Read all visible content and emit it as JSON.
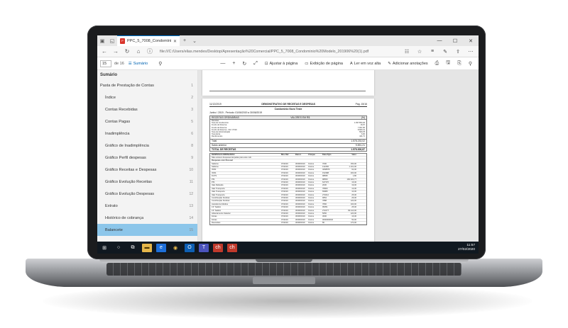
{
  "browser": {
    "tab_title": "PPC_5_7008_Condomínio",
    "url": "file:///C:/Users/elias.mendes/Desktop/Apresentação%20Comercial/PPC_5_7008_Condominio%20Modelo_201906%20(1).pdf"
  },
  "pdf_toolbar": {
    "page_current": "15",
    "page_total": "de 16",
    "summary": "Sumário",
    "fit_page": "Ajustar à página",
    "page_view": "Exibição de página",
    "read_aloud": "Ler em voz alta",
    "add_notes": "Adicionar anotações"
  },
  "sidebar": {
    "title": "Sumário",
    "items": [
      {
        "label": "Pasta de Prestação de Contas",
        "page": "1"
      },
      {
        "label": "Índice",
        "page": "2"
      },
      {
        "label": "Contas Recebidas",
        "page": "3"
      },
      {
        "label": "Contas Pagas",
        "page": "5"
      },
      {
        "label": "Inadimplência",
        "page": "6"
      },
      {
        "label": "Gráfico de Inadimplência",
        "page": "8"
      },
      {
        "label": "Gráfico Perfil despesas",
        "page": "9"
      },
      {
        "label": "Gráfico Receitas e Despesas",
        "page": "10"
      },
      {
        "label": "Gráfico Evolução Receitas",
        "page": "11"
      },
      {
        "label": "Gráfico Evolução Despesas",
        "page": "12"
      },
      {
        "label": "Extrato",
        "page": "13"
      },
      {
        "label": "Histórico de cobrança",
        "page": "14"
      },
      {
        "label": "Balancete",
        "page": "15"
      }
    ]
  },
  "document": {
    "date": "11/12/2019",
    "title": "DEMONSTRATIVO DE RECEITAS E DESPESAS",
    "page_label": "Pág. 15/16",
    "company": "Condomínio Novo Teste",
    "period": "Junho / 2019 - Período: 01/06/2019 a 30/06/2019",
    "receipts_header": "RECEITAS ORDINÁRIAS",
    "receipts_value_header": "VALORES EM R$",
    "receipts_pct_header": "(%)",
    "receipts_rows": [
      [
        "Receitas",
        ""
      ],
      [
        "Taxa de Condomínio",
        "1.097.850,46"
      ],
      [
        "Fundo de Reserva",
        "16,67"
      ],
      [
        "Fundo de Reserva",
        "7.097,96"
      ],
      [
        "Fundo de Reserva - Ref. 07/19",
        "8.683,41"
      ],
      [
        "Taxa de Administração",
        "569,78"
      ],
      [
        "Taxa Extra",
        "6,00"
      ],
      [
        "Rendimentos",
        "441,71"
      ]
    ],
    "total_label": "Total",
    "total_value": "1.578.233,02",
    "prev_balance_label": "Saldo anterior",
    "prev_balance": "9.591,21",
    "receipts_total_label": "TOTAL DE RECEITAS",
    "receipts_total": "1.578.306,87",
    "expenses_header": "DESPESAS ORDINÁRIAS",
    "expenses_cols": [
      "Mês Ref.",
      "Banco",
      "Cheque",
      "Data Pgto",
      "Valor"
    ],
    "expenses_note": "Não existem despesas lançadas para este mês",
    "expenses_section": "Despesas com Pessoal",
    "expenses_rows": [
      [
        "Salários",
        "07/2019",
        "30/08/2019",
        "Outros",
        "7000",
        "150,00"
      ],
      [
        "Salários",
        "07/2019",
        "30/08/2019",
        "Outros",
        "132460",
        "1.101,00"
      ],
      [
        "INSS",
        "07/2019",
        "30/08/2019",
        "Outros",
        "4068876",
        "62,00"
      ],
      [
        "INSS",
        "07/2019",
        "30/08/2019",
        "Outros",
        "152388",
        "200,00"
      ],
      [
        "FGTS",
        "07/2019",
        "30/08/2019",
        "Outros",
        "98835",
        "1,80"
      ],
      [
        "PIS",
        "07/2019",
        "30/08/2019",
        "Outros",
        "98650",
        "160.320,77"
      ],
      [
        "PIS",
        "07/2019",
        "30/08/2019",
        "Outros",
        "647370",
        "16,00"
      ],
      [
        "Vale Refeição",
        "07/2019",
        "30/08/2019",
        "Outros",
        "2030",
        "19,00"
      ],
      [
        "Vale Transporte",
        "07/2019",
        "30/08/2019",
        "Outros",
        "78900",
        "13,00"
      ],
      [
        "Vale Transporte",
        "07/2019",
        "30/08/2019",
        "Outros",
        "69980",
        "10,00"
      ],
      [
        "Vale Transporte",
        "07/2019",
        "30/08/2019",
        "Outros",
        "273212",
        "25,00"
      ],
      [
        "Contribuição Sindical",
        "07/2019",
        "30/08/2019",
        "Outros",
        "9654",
        "26,00"
      ],
      [
        "Contribuição Sindical",
        "07/2019",
        "30/08/2019",
        "Outros",
        "7888",
        "120,00"
      ],
      [
        "Assistência Médica",
        "07/2019",
        "30/08/2019",
        "Outros",
        "7800",
        "100,00"
      ],
      [
        "13º Salário",
        "07/2019",
        "30/08/2019",
        "Outros",
        "95351",
        "25,00"
      ],
      [
        "13º Salário",
        "07/2019",
        "30/08/2019",
        "Outros",
        "272277",
        "82.110,00"
      ],
      [
        "Adiantamento Salarial",
        "07/2019",
        "30/08/2019",
        "Outros",
        "5050",
        "120,00"
      ],
      [
        "Férias",
        "07/2019",
        "30/08/2019",
        "Outros",
        "3000",
        "16,00"
      ],
      [
        "Férias",
        "07/2019",
        "30/08/2019",
        "Outros",
        "0000000040",
        "50,00"
      ],
      [
        "Rescisões",
        "07/2019",
        "30/08/2019",
        "Outros",
        "80",
        "170,00"
      ]
    ]
  },
  "taskbar": {
    "time": "11:57",
    "date": "27/02/2020"
  }
}
